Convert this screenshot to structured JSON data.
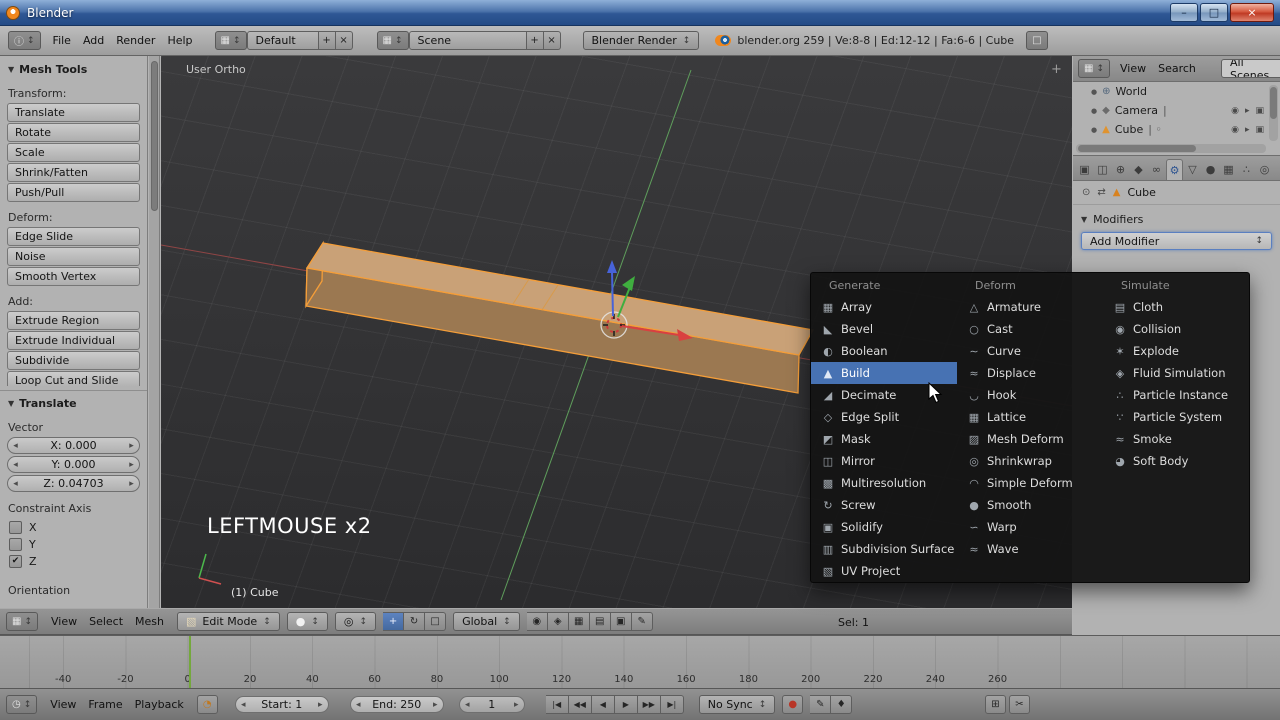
{
  "window": {
    "title": "Blender"
  },
  "ui": {
    "caret_down": "▼",
    "updown": "↕",
    "nav_left": "◂",
    "nav_right": "▸",
    "check_glyph": "✔",
    "plus": "+",
    "close_x": "×",
    "minimize": "–",
    "maximize": "□",
    "editor_icon_grid": "▦",
    "editor_icon_info": "ⓘ",
    "editor_icon_time": "◷",
    "add_region": "+"
  },
  "colors": {
    "selection_blue": "#4772b3",
    "object_orange": "#e0932f",
    "edge_select_orange": "#f59e39",
    "axis_x_red": "#9c4444",
    "axis_y_green": "#61a85f",
    "axis_z_blue": "#4763d9"
  },
  "info_bar": {
    "menus": [
      "File",
      "Add",
      "Render",
      "Help"
    ],
    "screen_value": "Default",
    "scene_value": "Scene",
    "engine_value": "Blender Render",
    "stats": "blender.org 259 | Ve:8-8 | Ed:12-12 | Fa:6-6 | Cube"
  },
  "tool_shelf": {
    "panel_title": "Mesh Tools",
    "sections": [
      {
        "label": "Transform:",
        "buttons": [
          "Translate",
          "Rotate",
          "Scale",
          "Shrink/Fatten",
          "Push/Pull"
        ]
      },
      {
        "label": "Deform:",
        "buttons": [
          "Edge Slide",
          "Noise",
          "Smooth Vertex"
        ]
      },
      {
        "label": "Add:",
        "buttons": [
          "Extrude Region",
          "Extrude Individual",
          "Subdivide",
          "Loop Cut and Slide"
        ]
      }
    ],
    "operator_panel": {
      "title": "Translate",
      "vector_label": "Vector",
      "fields": [
        "X: 0.000",
        "Y: 0.000",
        "Z: 0.04703"
      ],
      "constraint_label": "Constraint Axis",
      "axes": [
        {
          "name": "constraint-axis-x",
          "label": "X",
          "check": ""
        },
        {
          "name": "constraint-axis-y",
          "label": "Y",
          "check": ""
        },
        {
          "name": "constraint-axis-z",
          "label": "Z",
          "check": "✔",
          "checked": true
        }
      ],
      "orientation_label": "Orientation"
    }
  },
  "viewport": {
    "view_label": "User Ortho",
    "object_info": "(1) Cube",
    "screencast": "LEFTMOUSE x2"
  },
  "modifier_menu": {
    "highlighted": "Build",
    "columns": [
      {
        "title": "Generate",
        "items": [
          {
            "name": "menu-item-array",
            "icon": "▦",
            "label": "Array"
          },
          {
            "name": "menu-item-bevel",
            "icon": "◣",
            "label": "Bevel"
          },
          {
            "name": "menu-item-boolean",
            "icon": "◐",
            "label": "Boolean"
          },
          {
            "name": "menu-item-build",
            "icon": "▲",
            "label": "Build",
            "highlighted": true
          },
          {
            "name": "menu-item-decimate",
            "icon": "◢",
            "label": "Decimate"
          },
          {
            "name": "menu-item-edge-split",
            "icon": "◇",
            "label": "Edge Split"
          },
          {
            "name": "menu-item-mask",
            "icon": "◩",
            "label": "Mask"
          },
          {
            "name": "menu-item-mirror",
            "icon": "◫",
            "label": "Mirror"
          },
          {
            "name": "menu-item-multiresolution",
            "icon": "▩",
            "label": "Multiresolution"
          },
          {
            "name": "menu-item-screw",
            "icon": "↻",
            "label": "Screw"
          },
          {
            "name": "menu-item-solidify",
            "icon": "▣",
            "label": "Solidify"
          },
          {
            "name": "menu-item-subdivision-surface",
            "icon": "▥",
            "label": "Subdivision Surface"
          },
          {
            "name": "menu-item-uv-project",
            "icon": "▧",
            "label": "UV Project"
          }
        ]
      },
      {
        "title": "Deform",
        "items": [
          {
            "name": "menu-item-armature",
            "icon": "△",
            "label": "Armature"
          },
          {
            "name": "menu-item-cast",
            "icon": "○",
            "label": "Cast"
          },
          {
            "name": "menu-item-curve",
            "icon": "∼",
            "label": "Curve"
          },
          {
            "name": "menu-item-displace",
            "icon": "≈",
            "label": "Displace"
          },
          {
            "name": "menu-item-hook",
            "icon": "◡",
            "label": "Hook"
          },
          {
            "name": "menu-item-lattice",
            "icon": "▦",
            "label": "Lattice"
          },
          {
            "name": "menu-item-mesh-deform",
            "icon": "▨",
            "label": "Mesh Deform"
          },
          {
            "name": "menu-item-shrinkwrap",
            "icon": "◎",
            "label": "Shrinkwrap"
          },
          {
            "name": "menu-item-simple-deform",
            "icon": "◠",
            "label": "Simple Deform"
          },
          {
            "name": "menu-item-smooth",
            "icon": "●",
            "label": "Smooth"
          },
          {
            "name": "menu-item-warp",
            "icon": "∽",
            "label": "Warp"
          },
          {
            "name": "menu-item-wave",
            "icon": "≈",
            "label": "Wave"
          }
        ]
      },
      {
        "title": "Simulate",
        "items": [
          {
            "name": "menu-item-cloth",
            "icon": "▤",
            "label": "Cloth"
          },
          {
            "name": "menu-item-collision",
            "icon": "◉",
            "label": "Collision"
          },
          {
            "name": "menu-item-explode",
            "icon": "✶",
            "label": "Explode"
          },
          {
            "name": "menu-item-fluid-simulation",
            "icon": "◈",
            "label": "Fluid Simulation"
          },
          {
            "name": "menu-item-particle-instance",
            "icon": "∴",
            "label": "Particle Instance"
          },
          {
            "name": "menu-item-particle-system",
            "icon": "∵",
            "label": "Particle System"
          },
          {
            "name": "menu-item-smoke",
            "icon": "≈",
            "label": "Smoke"
          },
          {
            "name": "menu-item-soft-body",
            "icon": "◕",
            "label": "Soft Body"
          }
        ]
      }
    ]
  },
  "outliner": {
    "menus": [
      "View",
      "Search"
    ],
    "display_filter": "All Scenes",
    "items": [
      {
        "dot": "●",
        "icon": "⊕",
        "label": "World",
        "suffix": ""
      },
      {
        "dot": "●",
        "icon": "◆",
        "label": "Camera",
        "suffix": "|"
      },
      {
        "dot": "●",
        "icon": "▲",
        "label": "Cube",
        "suffix": "| ◦"
      }
    ],
    "row_icons": [
      "◉",
      "▸",
      "▣"
    ]
  },
  "properties": {
    "tabs": [
      {
        "name": "render-tab",
        "icon": "▣"
      },
      {
        "name": "scene-tab",
        "icon": "◫"
      },
      {
        "name": "world-tab",
        "icon": "⊕"
      },
      {
        "name": "object-tab",
        "icon": "◆"
      },
      {
        "name": "constraints-tab",
        "icon": "∞"
      },
      {
        "name": "modifiers-tab",
        "icon": "⚙",
        "active": true
      },
      {
        "name": "object-data-tab",
        "icon": "▽"
      },
      {
        "name": "material-tab",
        "icon": "●"
      },
      {
        "name": "texture-tab",
        "icon": "▦"
      },
      {
        "name": "particles-tab",
        "icon": "∴"
      },
      {
        "name": "physics-tab",
        "icon": "◎"
      }
    ],
    "context_icons": [
      "⊙",
      "⇄"
    ],
    "object_icon": "▲",
    "object_label": "Cube",
    "modifiers_panel_title": "Modifiers",
    "add_modifier_label": "Add Modifier"
  },
  "viewport_header": {
    "menus": [
      "View",
      "Select",
      "Mesh"
    ],
    "mode_icon": "▧",
    "mode_label": "Edit Mode",
    "shading_icon": "●",
    "pivot_icon": "◎",
    "manip_buttons": [
      {
        "name": "manipulator-translate-button",
        "glyph": "+",
        "pressed": true
      },
      {
        "name": "manipulator-rotate-button",
        "glyph": "↻"
      },
      {
        "name": "manipulator-scale-button",
        "glyph": "□"
      }
    ],
    "orientation_label": "Global",
    "misc_buttons": [
      {
        "name": "proportional-edit-button",
        "glyph": "◉"
      },
      {
        "name": "snap-magnet-button",
        "glyph": "◈"
      },
      {
        "name": "snap-element-button",
        "glyph": "▦"
      },
      {
        "name": "occlude-geometry-button",
        "glyph": "▤"
      },
      {
        "name": "render-opengl-button",
        "glyph": "▣"
      },
      {
        "name": "render-opengl-anim-button",
        "glyph": "✎"
      }
    ],
    "selection_info": "Sel: 1"
  },
  "timeline": {
    "ticks": [
      "-40",
      "-20",
      "0",
      "20",
      "40",
      "60",
      "80",
      "100",
      "120",
      "140",
      "160",
      "180",
      "200",
      "220",
      "240",
      "260"
    ],
    "header": {
      "menus": [
        "View",
        "Frame",
        "Playback"
      ],
      "preview_icon": "◔",
      "start_field": "Start: 1",
      "end_field": "End: 250",
      "frame_field": "1",
      "playback_buttons": [
        {
          "name": "jump-to-start-button",
          "glyph": "|◀"
        },
        {
          "name": "prev-keyframe-button",
          "glyph": "◀◀"
        },
        {
          "name": "play-reverse-button",
          "glyph": "◀"
        },
        {
          "name": "play-button",
          "glyph": "▶"
        },
        {
          "name": "next-keyframe-button",
          "glyph": "▶▶"
        },
        {
          "name": "jump-to-end-button",
          "glyph": "▶|"
        }
      ],
      "sync_label": "No Sync",
      "record_icon": "●",
      "keying_buttons": [
        {
          "name": "keying-set-button",
          "glyph": "✎"
        },
        {
          "name": "insert-keyframe-button",
          "glyph": "♦"
        }
      ],
      "right_buttons": [
        {
          "name": "copy-screen-button",
          "glyph": "⊞"
        },
        {
          "name": "split-area-button",
          "glyph": "✂"
        }
      ]
    }
  }
}
